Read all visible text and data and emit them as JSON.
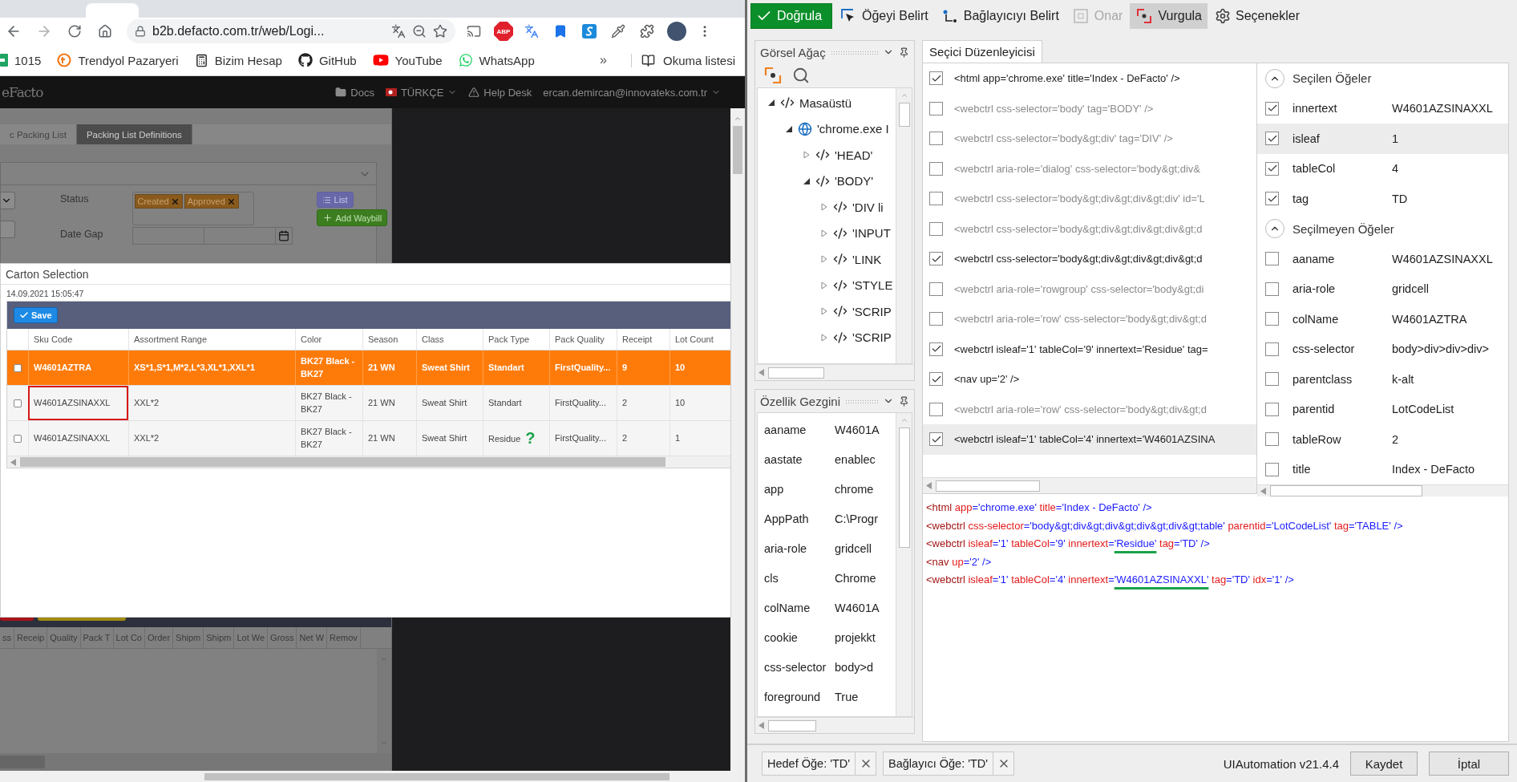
{
  "browser": {
    "address": "b2b.defacto.com.tr/web/Logi...",
    "adblock_label": "ABP",
    "bookmarks": [
      {
        "label": "1015",
        "kind": "sheet"
      },
      {
        "label": "Trendyol Pazaryeri",
        "kind": "trendyol"
      },
      {
        "label": "Bizim Hesap",
        "kind": "calculator"
      },
      {
        "label": "GitHub",
        "kind": "github"
      },
      {
        "label": "YouTube",
        "kind": "youtube"
      },
      {
        "label": "WhatsApp",
        "kind": "whatsapp"
      }
    ],
    "bookmarks_overflow": "»",
    "reading_list": "Okuma listesi"
  },
  "site": {
    "logo": "eFacto",
    "nav": [
      {
        "label": "Docs",
        "kind": "folder"
      },
      {
        "label": "TÜRKÇE",
        "kind": "flag"
      },
      {
        "label": "Help Desk",
        "kind": "warning"
      }
    ],
    "user": "ercan.demircan@innovateks.com.tr",
    "breadcrumbs": [
      {
        "label": "c Packing List",
        "selected": false
      },
      {
        "label": "Packing List Definitions",
        "selected": true
      }
    ],
    "filters": {
      "status_label": "Status",
      "status_tags": [
        "Created",
        "Approved"
      ],
      "date_label": "Date Gap",
      "list_button": "List",
      "add_button": "Add Waybill"
    },
    "grid_columns": [
      "ss",
      "Receip",
      "Quality",
      "Pack T",
      "Lot Co",
      "Order",
      "Shipm",
      "Shipm",
      "Lot We",
      "Gross",
      "Net W",
      "Remov"
    ]
  },
  "dialog": {
    "title": "Carton Selection",
    "timestamp": "14.09.2021 15:05:47",
    "save_button": "Save",
    "columns": [
      "Sku Code",
      "Assortment Range",
      "Color",
      "Season",
      "Class",
      "Pack Type",
      "Pack Quality",
      "Receipt",
      "Lot Count"
    ],
    "rows": [
      {
        "selected": true,
        "checked": false,
        "outlined": false,
        "cells": [
          "W4601AZTRA",
          "XS*1,S*1,M*2,L*3,XL*1,XXL*1",
          "BK27 Black - BK27",
          "21 WN",
          "Sweat Shirt",
          "Standart",
          "FirstQuality...",
          "9",
          "10"
        ]
      },
      {
        "selected": false,
        "checked": false,
        "outlined": true,
        "cells": [
          "W4601AZSINAXXL",
          "XXL*2",
          "BK27 Black - BK27",
          "21 WN",
          "Sweat Shirt",
          "Standart",
          "FirstQuality...",
          "2",
          "10"
        ]
      },
      {
        "selected": false,
        "checked": false,
        "outlined": false,
        "hint": "?",
        "cells": [
          "W4601AZSINAXXL",
          "XXL*2",
          "BK27 Black - BK27",
          "21 WN",
          "Sweat Shirt",
          "Residue",
          "FirstQuality...",
          "2",
          "1"
        ]
      }
    ]
  },
  "studio": {
    "toolbar": [
      {
        "label": "Doğrula",
        "kind": "validate",
        "selected": false,
        "disabled": false
      },
      {
        "label": "Öğeyi Belirt",
        "kind": "indicate-element",
        "selected": false,
        "disabled": false
      },
      {
        "label": "Bağlayıcıyı Belirt",
        "kind": "indicate-anchor",
        "selected": false,
        "disabled": false
      },
      {
        "label": "Onar",
        "kind": "repair",
        "selected": false,
        "disabled": true
      },
      {
        "label": "Vurgula",
        "kind": "highlight",
        "selected": true,
        "disabled": false
      },
      {
        "label": "Seçenekler",
        "kind": "options",
        "selected": false,
        "disabled": false
      }
    ],
    "tree": {
      "title": "Görsel Ağaç",
      "items": [
        {
          "label": "Masaüstü",
          "kind": "element",
          "expanded": true,
          "children": [
            {
              "label": "'chrome.exe I",
              "kind": "window",
              "expanded": true,
              "children": [
                {
                  "label": "'HEAD'",
                  "kind": "element",
                  "expanded": false
                },
                {
                  "label": "'BODY'",
                  "kind": "element",
                  "expanded": true,
                  "children": [
                    {
                      "label": "'DIV  li",
                      "kind": "element",
                      "expanded": false
                    },
                    {
                      "label": "'INPUT",
                      "kind": "element",
                      "expanded": false
                    },
                    {
                      "label": "'LINK",
                      "kind": "element",
                      "expanded": false
                    },
                    {
                      "label": "'STYLE",
                      "kind": "element",
                      "expanded": false
                    },
                    {
                      "label": "'SCRIP",
                      "kind": "element",
                      "expanded": false
                    },
                    {
                      "label": "'SCRIP",
                      "kind": "element",
                      "expanded": false
                    }
                  ]
                }
              ]
            }
          ]
        }
      ]
    },
    "properties": {
      "title": "Özellik Gezgini",
      "rows": [
        {
          "name": "aaname",
          "value": "W4601A"
        },
        {
          "name": "aastate",
          "value": "enablec"
        },
        {
          "name": "app",
          "value": "chrome"
        },
        {
          "name": "AppPath",
          "value": "C:\\Progr"
        },
        {
          "name": "aria-role",
          "value": "gridcell"
        },
        {
          "name": "cls",
          "value": "Chrome"
        },
        {
          "name": "colName",
          "value": "W4601A"
        },
        {
          "name": "cookie",
          "value": "projekkt"
        },
        {
          "name": "css-selector",
          "value": "body>d"
        },
        {
          "name": "foreground",
          "value": "True"
        }
      ]
    },
    "editor_tab": "Seçici Düzenleyicisi",
    "selector_items": [
      {
        "text": "<html app='chrome.exe' title='Index - DeFacto' />",
        "checked": true,
        "selected": false
      },
      {
        "text": "<webctrl css-selector='body' tag='BODY' />",
        "checked": false,
        "selected": false
      },
      {
        "text": "<webctrl css-selector='body&gt;div' tag='DIV' />",
        "checked": false,
        "selected": false
      },
      {
        "text": "<webctrl aria-role='dialog' css-selector='body&gt;div&",
        "checked": false,
        "selected": false
      },
      {
        "text": "<webctrl css-selector='body&gt;div&gt;div&gt;div' id='L",
        "checked": false,
        "selected": false
      },
      {
        "text": "<webctrl css-selector='body&gt;div&gt;div&gt;div&gt;d",
        "checked": false,
        "selected": false
      },
      {
        "text": "<webctrl css-selector='body&gt;div&gt;div&gt;div&gt;d",
        "checked": true,
        "selected": false
      },
      {
        "text": "<webctrl aria-role='rowgroup' css-selector='body&gt;di",
        "checked": false,
        "selected": false
      },
      {
        "text": "<webctrl aria-role='row' css-selector='body&gt;div&gt;d",
        "checked": false,
        "selected": false
      },
      {
        "text": "<webctrl isleaf='1' tableCol='9' innertext='Residue' tag=",
        "checked": true,
        "selected": false
      },
      {
        "text": "<nav up='2' />",
        "checked": true,
        "selected": false
      },
      {
        "text": "<webctrl aria-role='row' css-selector='body&gt;div&gt;d",
        "checked": false,
        "selected": false
      },
      {
        "text": "<webctrl isleaf='1' tableCol='4' innertext='W4601AZSINA",
        "checked": true,
        "selected": true
      }
    ],
    "attribute_groups": [
      {
        "title": "Seçilen Öğeler",
        "expanded": true,
        "items": [
          {
            "name": "innertext",
            "value": "W4601AZSINAXXL",
            "checked": true,
            "highlighted": false
          },
          {
            "name": "isleaf",
            "value": "1",
            "checked": true,
            "highlighted": true
          },
          {
            "name": "tableCol",
            "value": "4",
            "checked": true,
            "highlighted": false
          },
          {
            "name": "tag",
            "value": "TD",
            "checked": true,
            "highlighted": false
          }
        ]
      },
      {
        "title": "Seçilmeyen Öğeler",
        "expanded": true,
        "items": [
          {
            "name": "aaname",
            "value": "W4601AZSINAXXL",
            "checked": false,
            "highlighted": false
          },
          {
            "name": "aria-role",
            "value": "gridcell",
            "checked": false,
            "highlighted": false
          },
          {
            "name": "colName",
            "value": "W4601AZTRA",
            "checked": false,
            "highlighted": false
          },
          {
            "name": "css-selector",
            "value": "body>div>div>div>",
            "checked": false,
            "highlighted": false
          },
          {
            "name": "parentclass",
            "value": "k-alt",
            "checked": false,
            "highlighted": false
          },
          {
            "name": "parentid",
            "value": "LotCodeList",
            "checked": false,
            "highlighted": false
          },
          {
            "name": "tableRow",
            "value": "2",
            "checked": false,
            "highlighted": false
          },
          {
            "name": "title",
            "value": "Index - DeFacto",
            "checked": false,
            "highlighted": false
          }
        ]
      }
    ],
    "selector_lines": [
      [
        {
          "t": "<html",
          "kind": "tag"
        },
        {
          "t": " app",
          "kind": "attr"
        },
        {
          "t": "='chrome.exe'",
          "kind": "value"
        },
        {
          "t": " title",
          "kind": "attr"
        },
        {
          "t": "='Index - DeFacto'",
          "kind": "value"
        },
        {
          "t": " />",
          "kind": "value"
        }
      ],
      [
        {
          "t": "<webctrl",
          "kind": "tag"
        },
        {
          "t": " css-selector",
          "kind": "attr"
        },
        {
          "t": "='body&gt;div&gt;div&gt;div&gt;div&gt;table'",
          "kind": "value"
        },
        {
          "t": " parentid",
          "kind": "attr"
        },
        {
          "t": "='LotCodeList'",
          "kind": "value"
        },
        {
          "t": " tag",
          "kind": "attr"
        },
        {
          "t": "='TABLE'",
          "kind": "value"
        },
        {
          "t": " />",
          "kind": "value"
        }
      ],
      [
        {
          "t": "<webctrl",
          "kind": "tag"
        },
        {
          "t": " isleaf",
          "kind": "attr"
        },
        {
          "t": "='1'",
          "kind": "value"
        },
        {
          "t": " tableCol",
          "kind": "attr"
        },
        {
          "t": "='9'",
          "kind": "value"
        },
        {
          "t": " innertext",
          "kind": "attr"
        },
        {
          "t": "=",
          "kind": "value"
        },
        {
          "t": "'Residue'",
          "kind": "marked"
        },
        {
          "t": " tag",
          "kind": "attr"
        },
        {
          "t": "='TD'",
          "kind": "value"
        },
        {
          "t": " />",
          "kind": "value"
        }
      ],
      [
        {
          "t": "<nav",
          "kind": "tag"
        },
        {
          "t": " up",
          "kind": "attr"
        },
        {
          "t": "='2'",
          "kind": "value"
        },
        {
          "t": " />",
          "kind": "value"
        }
      ],
      [
        {
          "t": "<webctrl",
          "kind": "tag"
        },
        {
          "t": " isleaf",
          "kind": "attr"
        },
        {
          "t": "='1'",
          "kind": "value"
        },
        {
          "t": " tableCol",
          "kind": "attr"
        },
        {
          "t": "='4'",
          "kind": "value"
        },
        {
          "t": " innertext",
          "kind": "attr"
        },
        {
          "t": "=",
          "kind": "value"
        },
        {
          "t": "'W4601AZSINAXXL'",
          "kind": "marked"
        },
        {
          "t": " tag",
          "kind": "attr"
        },
        {
          "t": "='TD'",
          "kind": "value"
        },
        {
          "t": " idx",
          "kind": "attr"
        },
        {
          "t": "='1'",
          "kind": "value"
        },
        {
          "t": " />",
          "kind": "value"
        }
      ]
    ],
    "footer": {
      "target": "Hedef Öğe: 'TD'",
      "anchor": "Bağlayıcı Öğe: 'TD'",
      "version": "UIAutomation v21.4.4",
      "buttons": [
        "Kaydet",
        "İptal"
      ]
    }
  }
}
